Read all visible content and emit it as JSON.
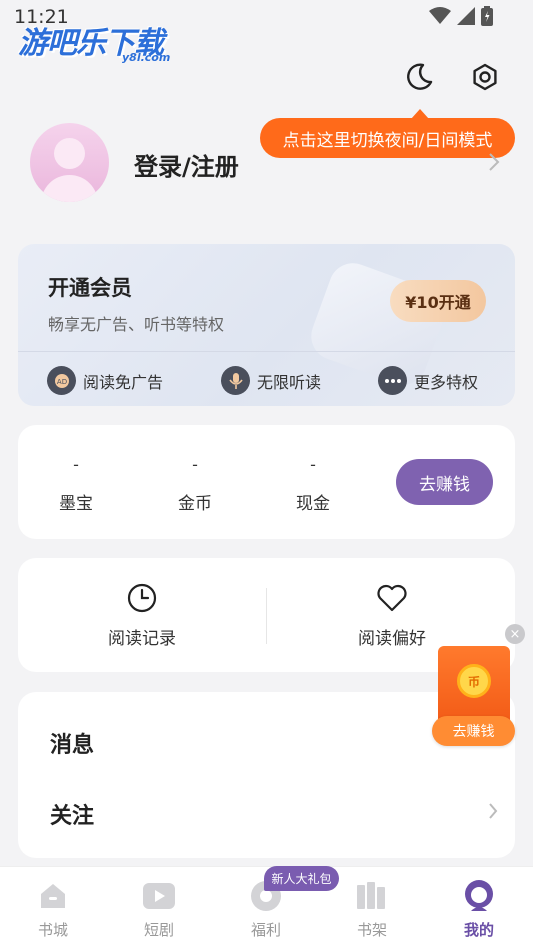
{
  "status_bar": {
    "time": "11:21"
  },
  "watermark": {
    "main": "游吧乐下载",
    "sub": "y8l.com"
  },
  "top_icons": [
    "moon-icon",
    "settings-icon"
  ],
  "tooltip": {
    "text": "点击这里切换夜间/日间模式",
    "color": "#ff6a1a"
  },
  "profile": {
    "login_label": "登录/注册"
  },
  "vip": {
    "title": "开通会员",
    "subtitle": "畅享无广告、听书等特权",
    "button": "¥10开通",
    "perks": [
      {
        "label": "阅读免广告",
        "icon": "ad-free-icon"
      },
      {
        "label": "无限听读",
        "icon": "microphone-icon"
      },
      {
        "label": "更多特权",
        "icon": "more-icon"
      }
    ]
  },
  "wallet": {
    "items": [
      {
        "label": "墨宝",
        "value": "-"
      },
      {
        "label": "金币",
        "value": "-"
      },
      {
        "label": "现金",
        "value": "-"
      }
    ],
    "earn_button": "去赚钱",
    "accent": "#7f62b0"
  },
  "history": {
    "items": [
      {
        "label": "阅读记录",
        "icon": "clock-icon"
      },
      {
        "label": "阅读偏好",
        "icon": "heart-icon"
      }
    ]
  },
  "floating_widget": {
    "button": "去赚钱",
    "coin": "币",
    "close": "×"
  },
  "menu": {
    "items": [
      {
        "label": "消息"
      },
      {
        "label": "关注"
      }
    ]
  },
  "bottom_nav": {
    "badge": "新人大礼包",
    "items": [
      {
        "label": "书城",
        "icon": "home-icon"
      },
      {
        "label": "短剧",
        "icon": "play-icon"
      },
      {
        "label": "福利",
        "icon": "gift-icon"
      },
      {
        "label": "书架",
        "icon": "bookshelf-icon"
      },
      {
        "label": "我的",
        "icon": "profile-icon"
      }
    ],
    "active_color": "#6a4fa6"
  }
}
